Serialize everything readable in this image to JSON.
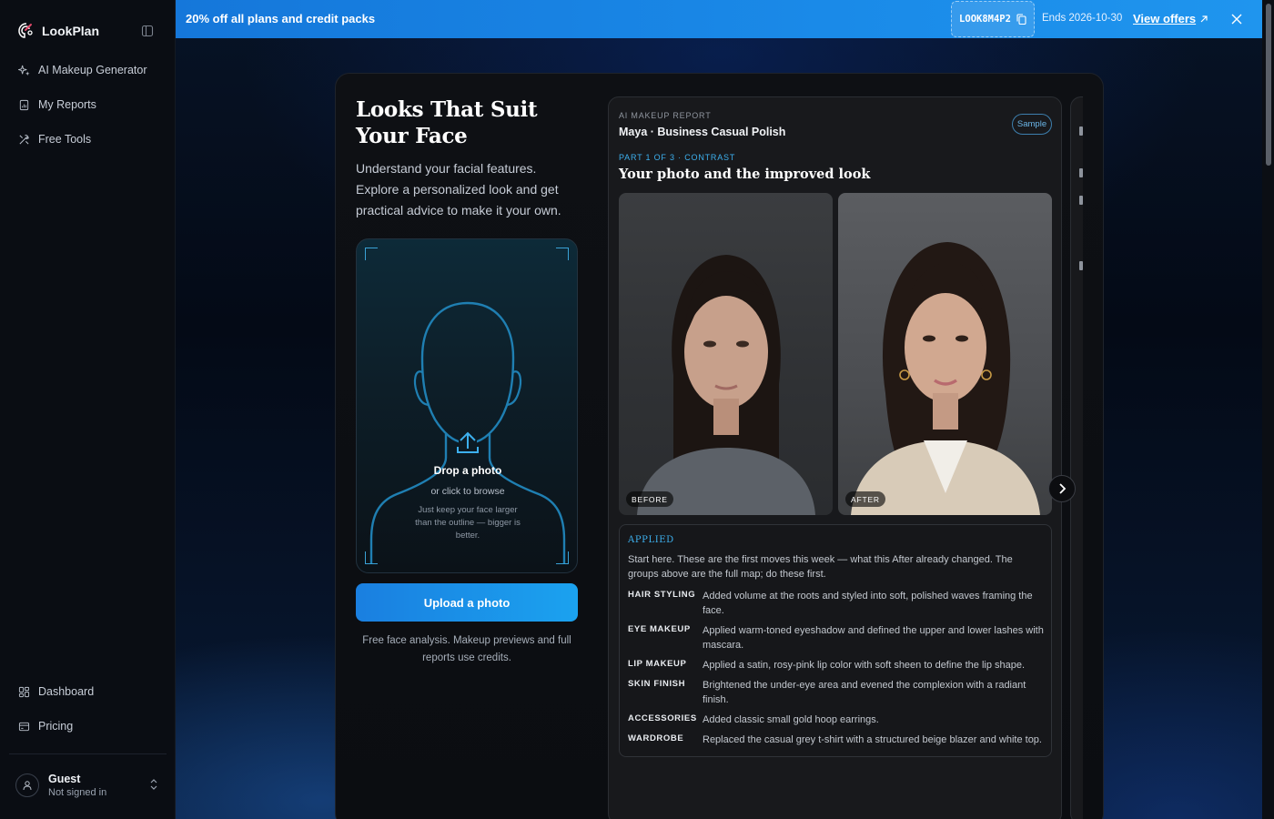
{
  "app": {
    "name": "LookPlan"
  },
  "sidebar": {
    "nav": [
      {
        "label": "AI Makeup Generator",
        "icon": "sparkles-icon"
      },
      {
        "label": "My Reports",
        "icon": "report-icon"
      },
      {
        "label": "Free Tools",
        "icon": "tools-icon"
      }
    ],
    "bottom_nav": [
      {
        "label": "Dashboard",
        "icon": "dashboard-icon"
      },
      {
        "label": "Pricing",
        "icon": "pricing-icon"
      }
    ],
    "user": {
      "name": "Guest",
      "status": "Not signed in"
    }
  },
  "promo": {
    "text": "20% off all plans and credit packs",
    "code": "LOOK8M4P2",
    "ends": "Ends 2026-10-30",
    "link": "View offers",
    "color": "#1a8ae8"
  },
  "hero": {
    "title": "Looks That Suit Your Face",
    "subtitle": "Understand your facial features. Explore a personalized look and get practical advice to make it your own.",
    "dropzone": {
      "title": "Drop a photo",
      "browse": "or click to browse",
      "hint": "Just keep your face larger than the outline — bigger is better."
    },
    "upload_button": "Upload a photo",
    "note": "Free face analysis. Makeup previews and full reports use credits."
  },
  "report": {
    "kicker": "AI MAKEUP REPORT",
    "name": "Maya · Business Casual Polish",
    "badge": "Sample",
    "part": "PART 1 OF 3 · CONTRAST",
    "heading": "Your photo and the improved look",
    "before_label": "BEFORE",
    "after_label": "AFTER",
    "applied": {
      "heading": "APPLIED",
      "intro": "Start here. These are the first moves this week — what this After already changed. The groups above are the full map; do these first.",
      "items": [
        {
          "label": "HAIR STYLING",
          "value": "Added volume at the roots and styled into soft, polished waves framing the face."
        },
        {
          "label": "EYE MAKEUP",
          "value": "Applied warm-toned eyeshadow and defined the upper and lower lashes with mascara."
        },
        {
          "label": "LIP MAKEUP",
          "value": "Applied a satin, rosy-pink lip color with soft sheen to define the lip shape."
        },
        {
          "label": "SKIN FINISH",
          "value": "Brightened the under-eye area and evened the complexion with a radiant finish."
        },
        {
          "label": "ACCESSORIES",
          "value": "Added classic small gold hoop earrings."
        },
        {
          "label": "WARDROBE",
          "value": "Replaced the casual grey t-shirt with a structured beige blazer and white top."
        }
      ]
    }
  }
}
